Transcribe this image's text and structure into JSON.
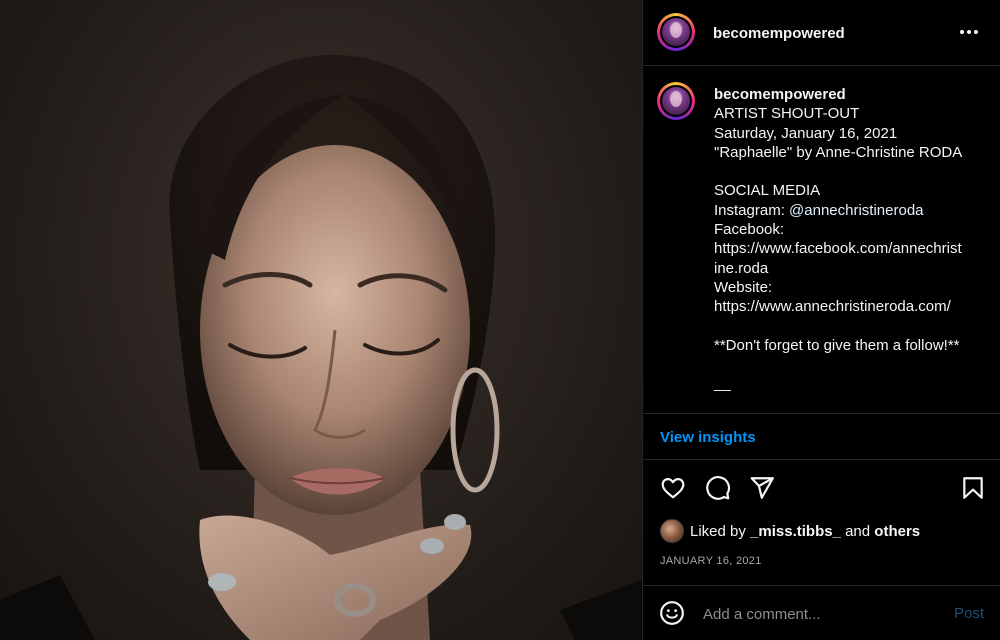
{
  "post": {
    "username": "becomempowered",
    "caption_lines": [
      "ARTIST SHOUT-OUT",
      "Saturday, January 16, 2021",
      "\"Raphaelle\" by Anne-Christine RODA",
      "",
      "SOCIAL MEDIA",
      "Instagram: ",
      "Facebook:",
      "https://www.facebook.com/annechrist",
      "ine.roda",
      "Website:",
      "https://www.annechristineroda.com/",
      "",
      "**Don't forget to give them a follow!**",
      "",
      "__"
    ],
    "mention": "@annechristineroda",
    "view_insights_label": "View insights",
    "liked_by_prefix": "Liked by ",
    "liked_by_user": "_miss.tibbs_",
    "liked_by_and": " and ",
    "liked_by_others": "others",
    "date": "JANUARY 16, 2021",
    "comment_placeholder": "Add a comment...",
    "post_label": "Post"
  },
  "icons": {
    "more": "more-options-icon",
    "like": "heart-icon",
    "comment": "comment-icon",
    "share": "send-icon",
    "save": "bookmark-icon",
    "emoji": "emoji-icon"
  },
  "colors": {
    "background": "#000000",
    "link_blue": "#0095f6",
    "muted": "#a8a8a8",
    "mention": "#e0f1ff",
    "post_disabled": "#1f4d74"
  }
}
